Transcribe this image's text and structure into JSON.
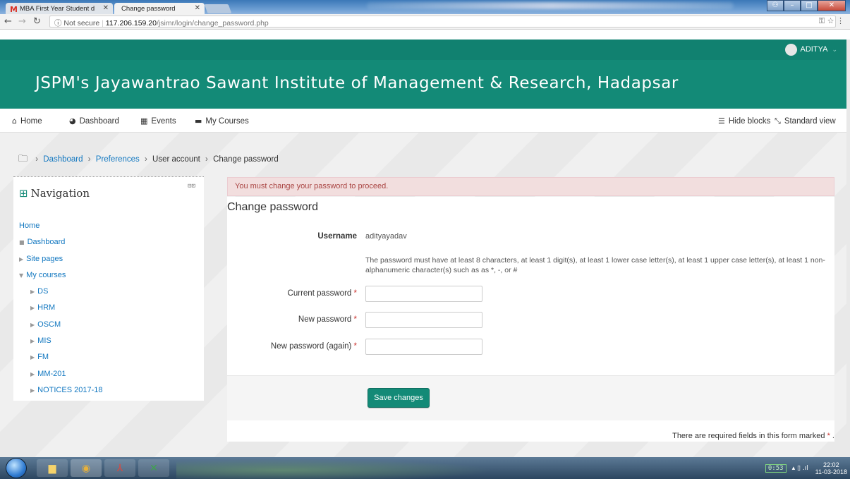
{
  "browser": {
    "tabs": [
      {
        "title": "MBA First Year Student d",
        "favicon": "gmail-icon"
      },
      {
        "title": "Change password",
        "favicon": "none"
      }
    ],
    "secure_label": "ⓘ Not secure",
    "url_host": "117.206.159.20",
    "url_path": "/jsimr/login/change_password.php"
  },
  "header": {
    "user_name": "ADITYA",
    "site_title": "JSPM's Jayawantrao Sawant Institute of Management & Research, Hadapsar"
  },
  "mainnav": {
    "home": "Home",
    "dashboard": "Dashboard",
    "events": "Events",
    "my_courses": "My Courses",
    "hide_blocks": "Hide blocks",
    "standard_view": "Standard view"
  },
  "breadcrumb": {
    "dashboard": "Dashboard",
    "preferences": "Preferences",
    "user_account": "User account",
    "change_password": "Change password"
  },
  "navigation": {
    "title": "Navigation",
    "home": "Home",
    "dashboard": "Dashboard",
    "site_pages": "Site pages",
    "my_courses": "My courses",
    "courses": [
      "DS",
      "HRM",
      "OSCM",
      "MIS",
      "FM",
      "MM-201",
      "NOTICES 2017-18"
    ]
  },
  "form": {
    "alert": "You must change your password to proceed.",
    "heading": "Change password",
    "username_label": "Username",
    "username_value": "adityayadav",
    "password_policy": "The password must have at least 8 characters, at least 1 digit(s), at least 1 lower case letter(s), at least 1 upper case letter(s), at least 1 non-alphanumeric character(s) such as as *, -, or #",
    "current_password_label": "Current password",
    "new_password_label": "New password",
    "new_password_again_label": "New password (again)",
    "save_button": "Save changes",
    "required_note": "There are required fields in this form marked",
    "required_marker": "*"
  },
  "taskbar": {
    "battery": "0:53",
    "clock_time": "22:02",
    "clock_date": "11-03-2018"
  },
  "colors": {
    "brand": "#138a77",
    "topbar": "#118170",
    "link": "#1177c0",
    "alert_bg": "#f2dede",
    "alert_text": "#a94442",
    "required": "#c9302c"
  }
}
